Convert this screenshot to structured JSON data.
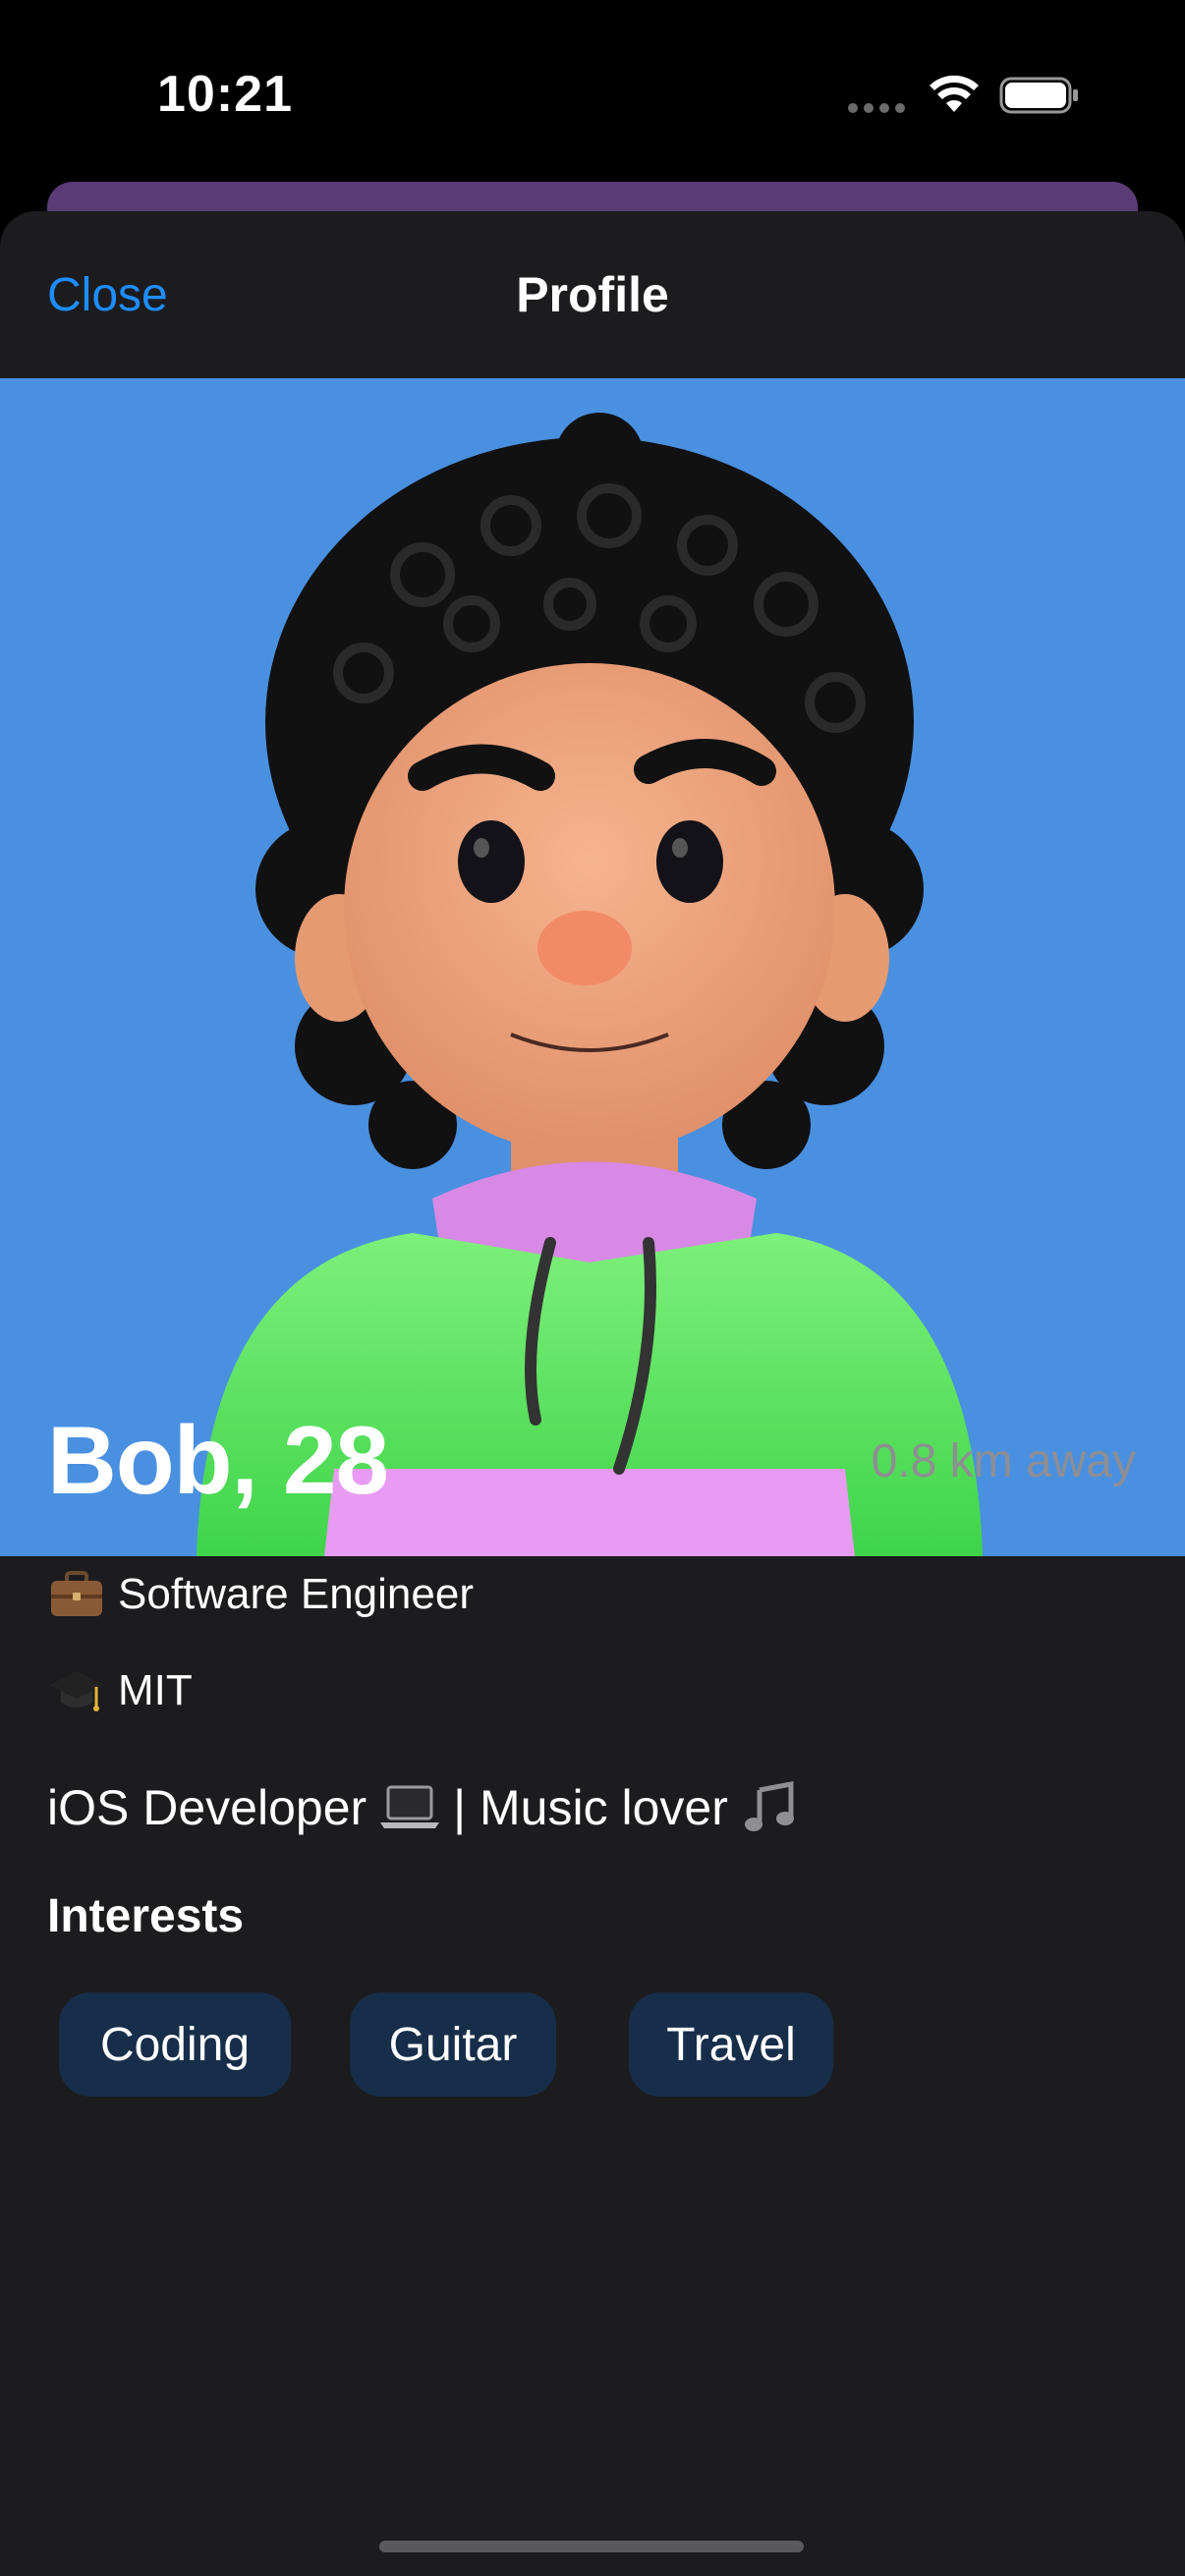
{
  "status_bar": {
    "time": "10:21",
    "icons": [
      "cellular-dots-icon",
      "wifi-icon",
      "battery-icon"
    ]
  },
  "nav": {
    "close_label": "Close",
    "title": "Profile"
  },
  "profile": {
    "photo": "avatar-illustration",
    "name_age": "Bob, 28",
    "distance": "0.8 km away",
    "job": {
      "icon": "briefcase-icon",
      "text": "Software Engineer"
    },
    "school": {
      "icon": "graduation-cap-icon",
      "text": "MIT"
    },
    "bio": {
      "part1": "iOS Developer",
      "icon1": "laptop-icon",
      "part2": "| Music lover",
      "icon2": "music-notes-icon"
    },
    "interests_heading": "Interests",
    "interests": [
      "Coding",
      "Guitar",
      "Travel"
    ]
  },
  "colors": {
    "accent": "#1e8dff",
    "sheet_background": "#1c1c1e",
    "photo_background": "#4a90e0",
    "chip_background": "#172e4a",
    "secondary_text": "#8e8e93"
  }
}
